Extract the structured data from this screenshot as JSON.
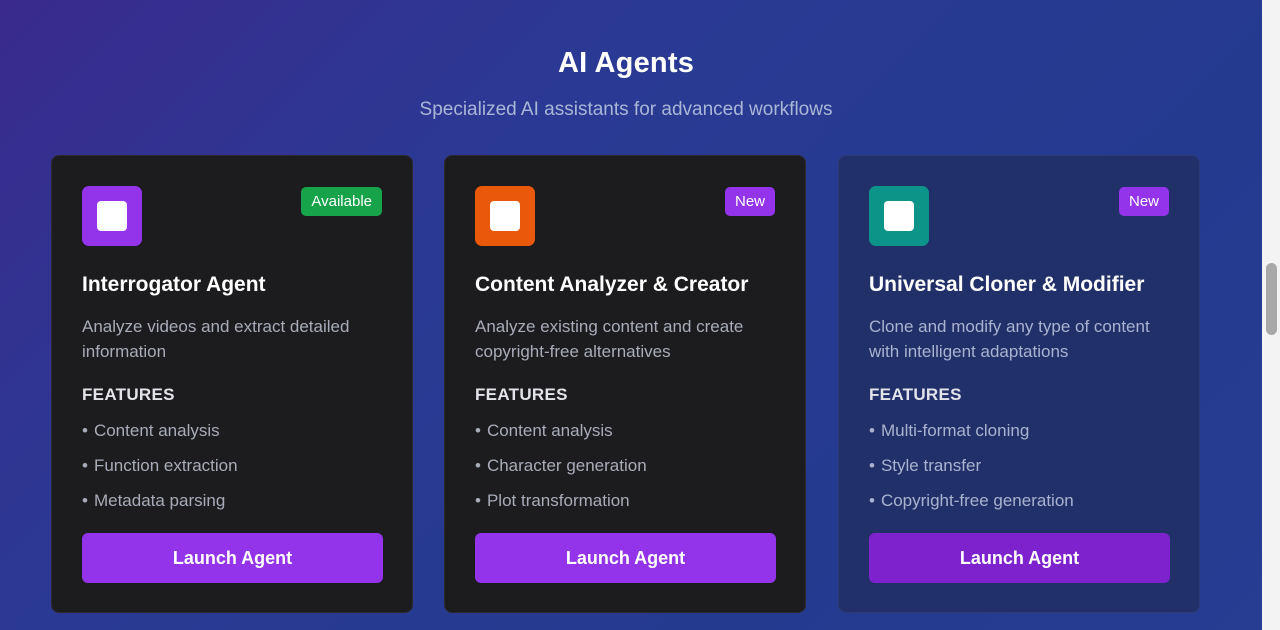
{
  "section": {
    "title": "AI Agents",
    "subtitle": "Specialized AI assistants for advanced workflows"
  },
  "cards": [
    {
      "icon_name": "agent-icon",
      "icon_color": "#9333ea",
      "badge": "Available",
      "badge_color": "#16a34a",
      "title": "Interrogator Agent",
      "description": "Analyze videos and extract detailed information",
      "features_label": "FEATURES",
      "features": [
        "Content analysis",
        "Function extraction",
        "Metadata parsing"
      ],
      "button": "Launch Agent"
    },
    {
      "icon_name": "agent-icon",
      "icon_color": "#ea580c",
      "badge": "New",
      "badge_color": "#9333ea",
      "title": "Content Analyzer & Creator",
      "description": "Analyze existing content and create copyright-free alternatives",
      "features_label": "FEATURES",
      "features": [
        "Content analysis",
        "Character generation",
        "Plot transformation"
      ],
      "button": "Launch Agent"
    },
    {
      "icon_name": "agent-icon",
      "icon_color": "#0d9488",
      "badge": "New",
      "badge_color": "#9333ea",
      "title": "Universal Cloner & Modifier",
      "description": "Clone and modify any type of content with intelligent adaptations",
      "features_label": "FEATURES",
      "features": [
        "Multi-format cloning",
        "Style transfer",
        "Copyright-free generation"
      ],
      "button": "Launch Agent"
    }
  ]
}
